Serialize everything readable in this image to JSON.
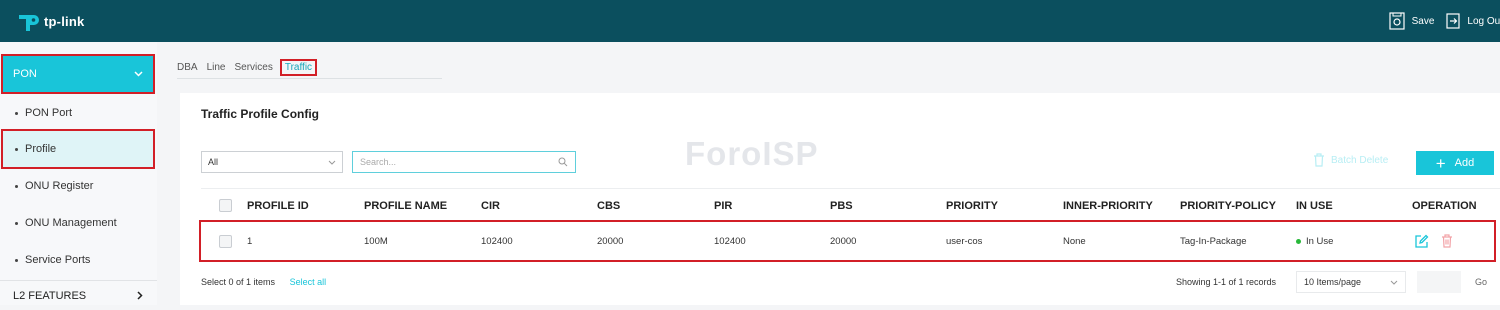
{
  "header": {
    "brand": "tp-link",
    "save_label": "Save",
    "logout_label": "Log Out"
  },
  "sidebar": {
    "section_title": "PON",
    "items": [
      {
        "label": "PON Port"
      },
      {
        "label": "Profile"
      },
      {
        "label": "ONU Register"
      },
      {
        "label": "ONU Management"
      },
      {
        "label": "Service Ports"
      }
    ],
    "next_section": "L2 FEATURES"
  },
  "tabs": [
    "DBA",
    "Line",
    "Services",
    "Traffic"
  ],
  "panel": {
    "title": "Traffic Profile Config",
    "filter_value": "All",
    "search_placeholder": "Search...",
    "watermark": "ForoISP",
    "batch_delete_label": "Batch Delete",
    "add_label": "Add"
  },
  "table": {
    "columns": [
      "PROFILE ID",
      "PROFILE NAME",
      "CIR",
      "CBS",
      "PIR",
      "PBS",
      "PRIORITY",
      "INNER-PRIORITY",
      "PRIORITY-POLICY",
      "IN USE",
      "OPERATION"
    ],
    "rows": [
      {
        "id": "1",
        "name": "100M",
        "cir": "102400",
        "cbs": "20000",
        "pir": "102400",
        "pbs": "20000",
        "priority": "user-cos",
        "inner_priority": "None",
        "policy": "Tag-In-Package",
        "in_use": "In Use"
      }
    ]
  },
  "footer": {
    "selected_text": "Select 0 of 1 items",
    "select_all_label": "Select all",
    "records_text": "Showing 1-1 of 1 records",
    "page_size": "10 Items/page",
    "go_label": "Go"
  },
  "colors": {
    "topbar": "#0b4f5e",
    "accent": "#19c5d9",
    "highlight_box": "#d21f27",
    "in_use": "#28b83a"
  }
}
